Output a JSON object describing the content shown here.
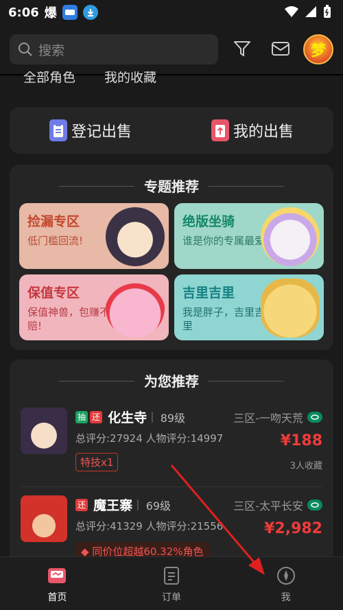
{
  "status": {
    "time": "6:06",
    "app_glyph": "爆"
  },
  "header": {
    "search_placeholder": "搜索",
    "avatar_text": "梦"
  },
  "tabs_partial": [
    "全部角色",
    "我的收藏"
  ],
  "sell": {
    "register": "登记出售",
    "mine": "我的出售"
  },
  "topics": {
    "title": "专题推荐",
    "items": [
      {
        "title": "捡漏专区",
        "desc": "低门槛回流!",
        "bg": "#e8b9a6",
        "fg": "#c4482e"
      },
      {
        "title": "绝版坐骑",
        "desc": "谁是你的专属最爱",
        "bg": "#9fd8c8",
        "fg": "#15866a"
      },
      {
        "title": "保值专区",
        "desc": "保值神兽，包赚不赔!",
        "bg": "#f1b5bd",
        "fg": "#c4383e"
      },
      {
        "title": "吉里吉里",
        "desc": "我是胖子，吉里吉里",
        "bg": "#8fd6d3",
        "fg": "#157f80"
      }
    ]
  },
  "recommend": {
    "title": "为您推荐",
    "items": [
      {
        "tags": [
          "抽",
          "还"
        ],
        "name": "化生寺",
        "level": "89级",
        "server": "三区-一吻天荒",
        "score": "总评分:27924 人物评分:14997",
        "price": "¥188",
        "fav": "3人收藏",
        "chip": "特技x1"
      },
      {
        "tags": [
          "还"
        ],
        "name": "魔王寨",
        "level": "69级",
        "server": "三区-太平长安",
        "score": "总评分:41329 人物评分:21556",
        "price": "¥2,982",
        "fav": "",
        "chip": "同价位超越60.32%角色"
      }
    ]
  },
  "nav": [
    {
      "label": "首页",
      "active": true
    },
    {
      "label": "订单",
      "active": false
    },
    {
      "label": "我",
      "active": false
    }
  ],
  "colors": {
    "accent_red": "#ef3b3b",
    "server_green": "#0a8a5f",
    "tag_green": "#1aa260",
    "tag_red": "#e23b3b"
  }
}
